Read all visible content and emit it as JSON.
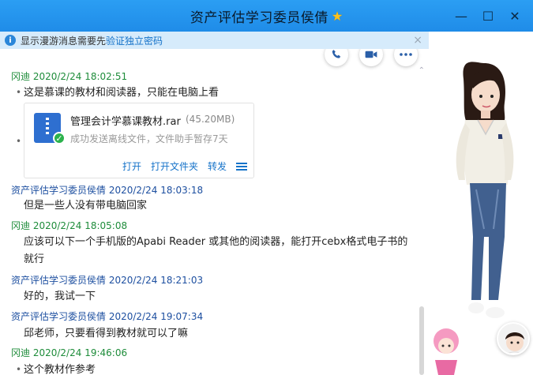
{
  "window": {
    "title": "资产评估学习委员侯倩",
    "star_icon": "star-icon",
    "minimize": "—",
    "restore": "☐",
    "close": "✕"
  },
  "notice": {
    "text": "显示漫游消息需要先",
    "link": "验证独立密码",
    "close": "×"
  },
  "toolbar": {
    "icons": [
      "phone-icon",
      "video-icon",
      "more-icon"
    ]
  },
  "messages": [
    {
      "sender": "冈迪",
      "time": "2020/2/24 18:02:51",
      "text": "这是慕课的教材和阅读器，只能在电脑上看"
    },
    {
      "sender": "资产评估学习委员侯倩",
      "time": "2020/2/24 18:03:18",
      "text": "但是一些人没有带电脑回家"
    },
    {
      "sender": "冈迪",
      "time": "2020/2/24 18:05:08",
      "text": "应该可以下一个手机版的Apabi Reader 或其他的阅读器，能打开cebx格式电子书的就行"
    },
    {
      "sender": "资产评估学习委员侯倩",
      "time": "2020/2/24 18:21:03",
      "text": "好的，我试一下"
    },
    {
      "sender": "资产评估学习委员侯倩",
      "time": "2020/2/24 19:07:34",
      "text": "邱老师，只要看得到教材就可以了嘛"
    },
    {
      "sender": "冈迪",
      "time": "2020/2/24 19:46:06",
      "text": "这个教材作参考"
    }
  ],
  "file": {
    "name": "管理会计学慕课教材.rar",
    "size": "(45.20MB)",
    "status": "成功发送离线文件，文件助手暂存7天",
    "actions": [
      "打开",
      "打开文件夹",
      "转发"
    ]
  },
  "colors": {
    "titlebar": "#2b9ef3",
    "notice_bg": "#d6ebfb",
    "link": "#1673c9",
    "sender_self": "#1e8c3a",
    "sender_other": "#1d4fa0"
  }
}
